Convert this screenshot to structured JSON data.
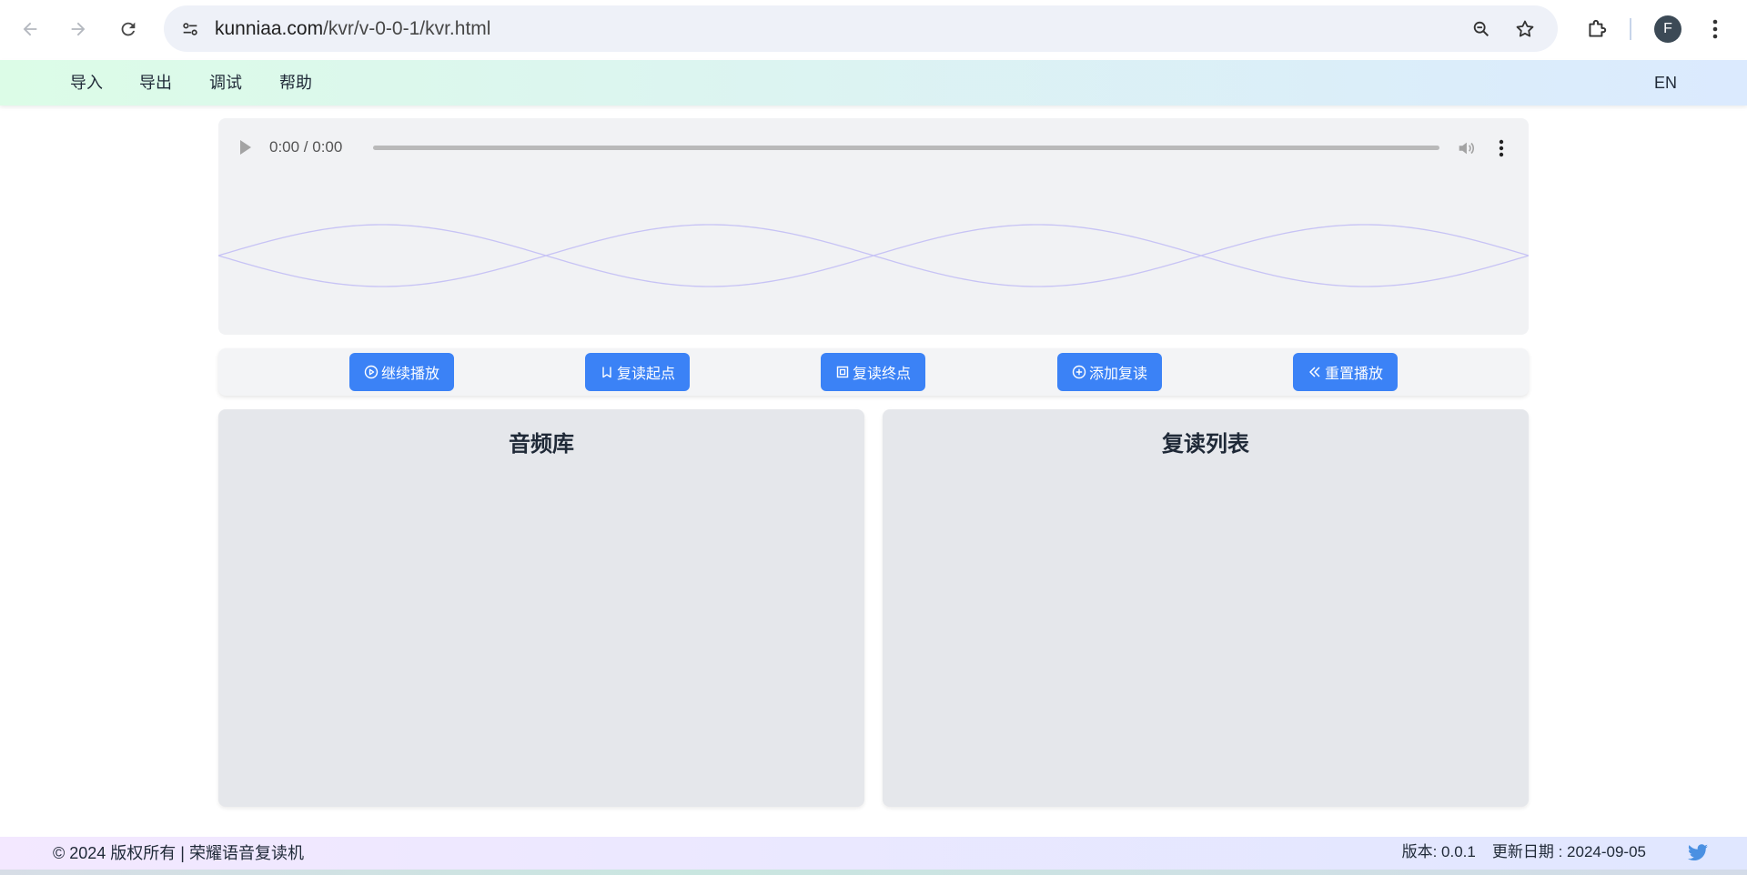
{
  "browser": {
    "url_host": "kunniaa.com",
    "url_path": "/kvr/v-0-0-1/kvr.html",
    "profile_initial": "F",
    "icons": [
      "back-arrow-icon",
      "forward-arrow-icon",
      "reload-icon",
      "site-settings-icon",
      "zoom-icon",
      "bookmark-star-icon",
      "extensions-icon",
      "kebab-menu-icon"
    ]
  },
  "menubar": {
    "items": [
      {
        "label": "导入"
      },
      {
        "label": "导出"
      },
      {
        "label": "调试"
      },
      {
        "label": "帮助"
      }
    ],
    "lang": "EN"
  },
  "player": {
    "time": "0:00 / 0:00",
    "wave_color": "#c7c3f5"
  },
  "controls": [
    {
      "label": "继续播放",
      "icon": "play-circle-icon"
    },
    {
      "label": "复读起点",
      "icon": "bookmark-start-icon"
    },
    {
      "label": "复读终点",
      "icon": "stop-square-icon"
    },
    {
      "label": "添加复读",
      "icon": "plus-circle-icon"
    },
    {
      "label": "重置播放",
      "icon": "rewind-icon"
    }
  ],
  "panels": {
    "library_title": "音频库",
    "repeat_list_title": "复读列表"
  },
  "footer": {
    "copyright": "© 2024 版权所有 | 荣耀语音复读机",
    "version": "版本: 0.0.1",
    "updated": "更新日期 : 2024-09-05",
    "social_icon": "twitter-icon"
  },
  "colors": {
    "accent": "#3b82f6",
    "twitter": "#4a90e2"
  }
}
